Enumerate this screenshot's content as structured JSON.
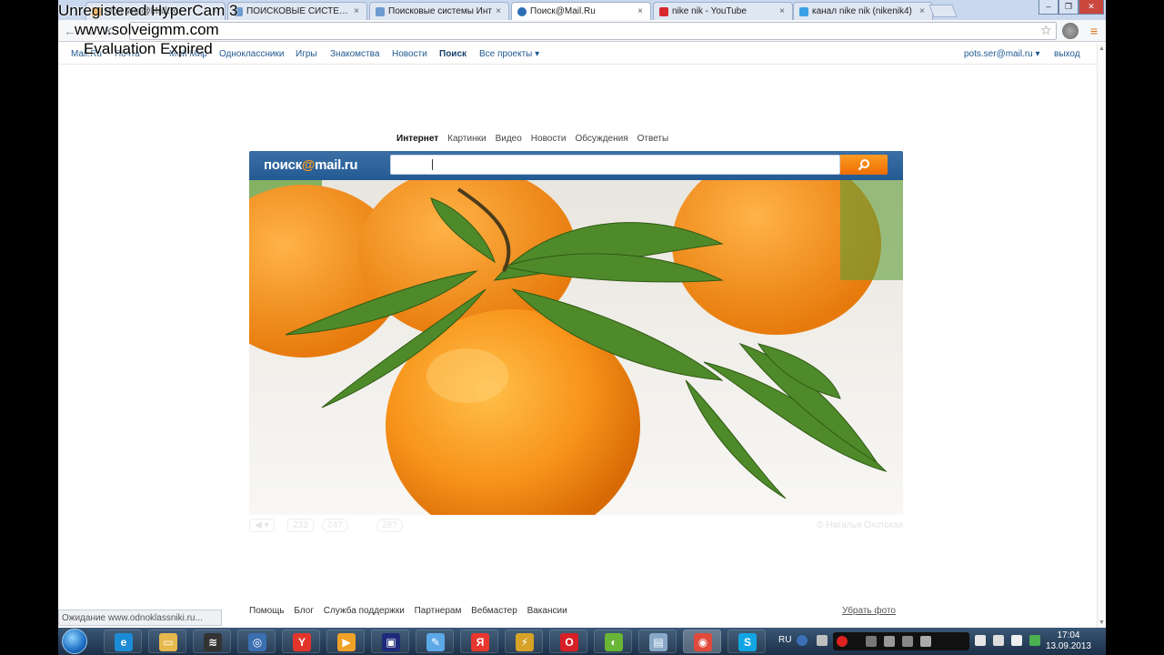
{
  "watermark": {
    "line1": "Unregistered HyperCam 3",
    "line2": "www.solveigmm.com",
    "line3": "Evaluation Expired"
  },
  "browser": {
    "tabs": [
      {
        "label": "Мой мир@Mail.Ru",
        "active": false,
        "favicon_color": "#f29a1b"
      },
      {
        "label": "ПОИСКОВЫЕ СИСТЕМЫ",
        "active": false,
        "favicon_color": "#6d9ad1"
      },
      {
        "label": "Поисковые системы Инт",
        "active": false,
        "favicon_color": "#6d9ad1"
      },
      {
        "label": "Поиск@Mail.Ru",
        "active": true,
        "favicon_color": "#2d6db6"
      },
      {
        "label": "nike nik - YouTube",
        "active": false,
        "favicon_color": "#d9272e"
      },
      {
        "label": "канал nike nik (nikenik4)",
        "active": false,
        "favicon_color": "#3aa1e6"
      }
    ],
    "close_glyph": "×",
    "window_buttons": [
      "–",
      "❐",
      "✕"
    ],
    "omnibox_value": "Ожидание www.odnoklassniki.ru..."
  },
  "mailbar": {
    "left_links": [
      "Мail.Ru",
      "Почта",
      "Мой Мир",
      "Одноклассники",
      "Игры",
      "Знакомства",
      "Новости",
      "Поиск",
      "Все проекты ▾"
    ],
    "active_link": "Поиск",
    "user": "pots.ser@mail.ru ▾",
    "logout": "выход"
  },
  "search": {
    "vertical_tabs": [
      "Интернет",
      "Картинки",
      "Видео",
      "Новости",
      "Обсуждения",
      "Ответы"
    ],
    "active_tab": "Интернет",
    "logo_text_a": "поиск",
    "logo_text_at": "@",
    "logo_text_b": "mail.ru",
    "input_value": "",
    "button_icon": "magnifier-icon"
  },
  "photo": {
    "author": "© Наталья Охотская",
    "controls": [
      "◀ ▾",
      "233",
      "24?",
      "28?"
    ]
  },
  "footer": {
    "links": [
      "Помощь",
      "Блог",
      "Служба поддержки",
      "Партнерам",
      "Вебмастер",
      "Вакансии"
    ],
    "hide_photo": "Убрать фото"
  },
  "status_bar": "Ожидание www.odnoklassniki.ru...",
  "taskbar": {
    "apps": [
      {
        "name": "ie",
        "glyph": "e",
        "color": "#1b8bd6"
      },
      {
        "name": "explorer",
        "glyph": "▭",
        "color": "#e5b94d"
      },
      {
        "name": "terminal",
        "glyph": "≋",
        "color": "#333"
      },
      {
        "name": "hypercam",
        "glyph": "◎",
        "color": "#3a6fb0"
      },
      {
        "name": "yandex",
        "glyph": "Y",
        "color": "#e3342c"
      },
      {
        "name": "media",
        "glyph": "▶",
        "color": "#f0a228"
      },
      {
        "name": "save",
        "glyph": "▣",
        "color": "#1e2a7a"
      },
      {
        "name": "paint",
        "glyph": "✎",
        "color": "#5ca9e8"
      },
      {
        "name": "yandex-browser",
        "glyph": "Я",
        "color": "#e8372e"
      },
      {
        "name": "tool",
        "glyph": "⚡",
        "color": "#d6a328"
      },
      {
        "name": "opera",
        "glyph": "O",
        "color": "#d81f26"
      },
      {
        "name": "game",
        "glyph": "◐",
        "color": "#69b535"
      },
      {
        "name": "window",
        "glyph": "▤",
        "color": "#8aa9c9"
      },
      {
        "name": "chrome",
        "glyph": "◉",
        "color": "#e04a3c",
        "active": true
      },
      {
        "name": "skype",
        "glyph": "S",
        "color": "#12a5e3"
      }
    ],
    "lang": "RU",
    "time": "17:04",
    "date": "13.09.2013"
  }
}
